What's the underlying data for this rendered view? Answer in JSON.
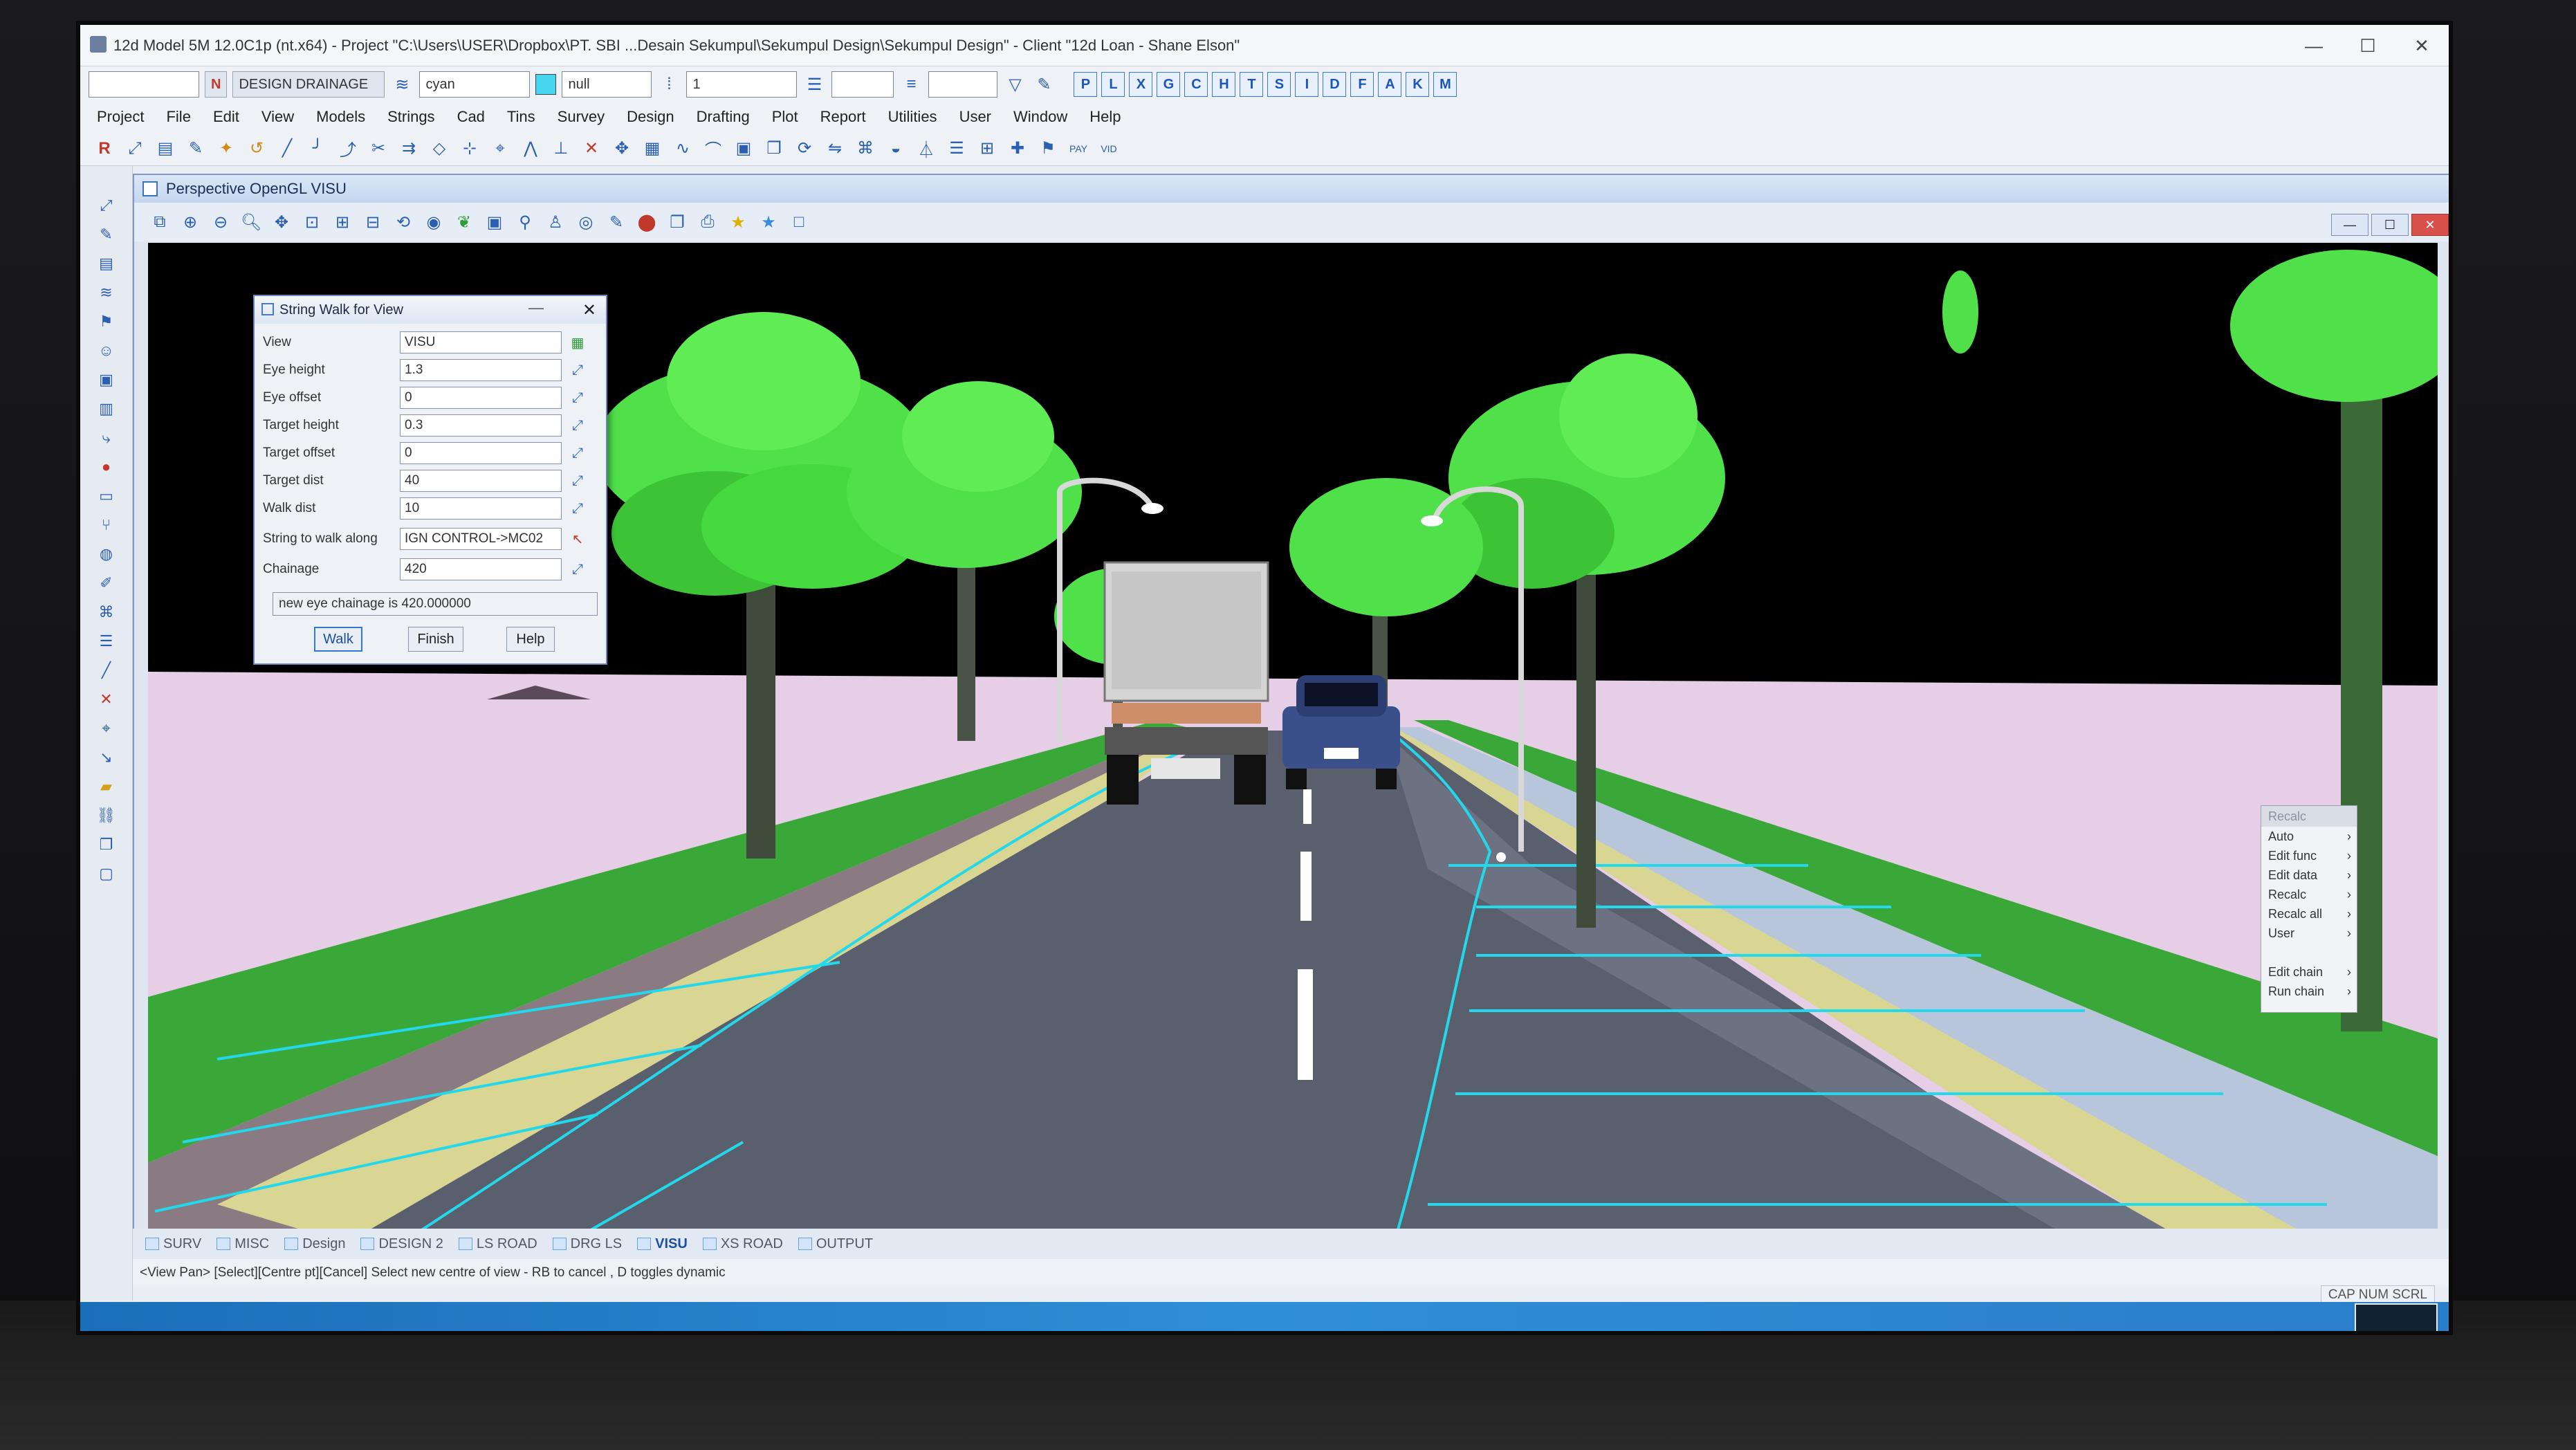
{
  "app": {
    "title": "12d Model 5M 12.0C1p (nt.x64) - Project \"C:\\Users\\USER\\Dropbox\\PT. SBI ...Desain Sekumpul\\Sekumpul Design\\Sekumpul Design\" - Client \"12d Loan - Shane Elson\"",
    "window_controls": {
      "minimize": "—",
      "maximize": "☐",
      "close": "✕"
    }
  },
  "toolbar1": {
    "model_box": "",
    "flag": "N",
    "model_name": "DESIGN DRAINAGE",
    "colour_name": "cyan",
    "colour_swatch": "#47d6f0",
    "style_name": "null",
    "weight_value": "1",
    "letter_buttons": [
      "P",
      "L",
      "X",
      "G",
      "C",
      "H",
      "T",
      "S",
      "I",
      "D",
      "F",
      "A",
      "K",
      "M"
    ]
  },
  "menubar": [
    "Project",
    "File",
    "Edit",
    "View",
    "Models",
    "Strings",
    "Cad",
    "Tins",
    "Survey",
    "Design",
    "Drafting",
    "Plot",
    "Report",
    "Utilities",
    "User",
    "Window",
    "Help"
  ],
  "tool_row_icons": [
    "r-icon",
    "pick-icon",
    "string-icon",
    "pen-icon",
    "arc-icon",
    "hook-icon",
    "line-icon",
    "fillet-icon",
    "extend-icon",
    "cut-icon",
    "offset-icon",
    "node-icon",
    "align-icon",
    "vertex-icon",
    "polyline-icon",
    "dimension-icon",
    "delete-icon",
    "move-icon",
    "grid-icon",
    "spline-icon",
    "curve-icon",
    "box-icon",
    "copy-icon",
    "rotate-icon",
    "mirror-icon",
    "edit-icon",
    "sweep-icon",
    "filter-icon",
    "stack-icon",
    "ruler-icon",
    "cross-icon",
    "tag-icon",
    "pay-icon",
    "vid-icon"
  ],
  "perspective": {
    "title": "Perspective OpenGL VISU",
    "controls": {
      "minimize": "—",
      "maximize": "☐",
      "close": "✕"
    }
  },
  "dialog": {
    "title": "String Walk for View",
    "fields": [
      {
        "label": "View",
        "value": "VISU"
      },
      {
        "label": "Eye height",
        "value": "1.3"
      },
      {
        "label": "Eye offset",
        "value": "0"
      },
      {
        "label": "Target height",
        "value": "0.3"
      },
      {
        "label": "Target offset",
        "value": "0"
      },
      {
        "label": "Target dist",
        "value": "40"
      },
      {
        "label": "Walk dist",
        "value": "10"
      },
      {
        "label": "String to walk along",
        "value": "IGN CONTROL->MC02"
      },
      {
        "label": "Chainage",
        "value": "420"
      }
    ],
    "message": "new eye chainage is 420.000000",
    "buttons": {
      "walk": "Walk",
      "finish": "Finish",
      "help": "Help"
    }
  },
  "context_menu": {
    "header": "Recalc",
    "items": [
      "Auto",
      "Edit func",
      "Edit data",
      "Recalc",
      "Recalc all",
      "User",
      "",
      "Edit chain",
      "Run chain"
    ]
  },
  "tabs": [
    "SURV",
    "MISC",
    "Design",
    "DESIGN 2",
    "LS ROAD",
    "DRG LS",
    "VISU",
    "XS ROAD",
    "OUTPUT"
  ],
  "active_tab": "VISU",
  "status": "<View Pan> [Select][Centre pt][Cancel] Select new centre of view - RB to cancel , D toggles dynamic",
  "status_flags": "CAP NUM SCRL",
  "colors": {
    "sky": "#000000",
    "ground": "#e6cfe6",
    "grass": "#3aa838",
    "road": "#5a5f6e",
    "lines": "#22d8ea",
    "foliage": "#4fe04a"
  }
}
